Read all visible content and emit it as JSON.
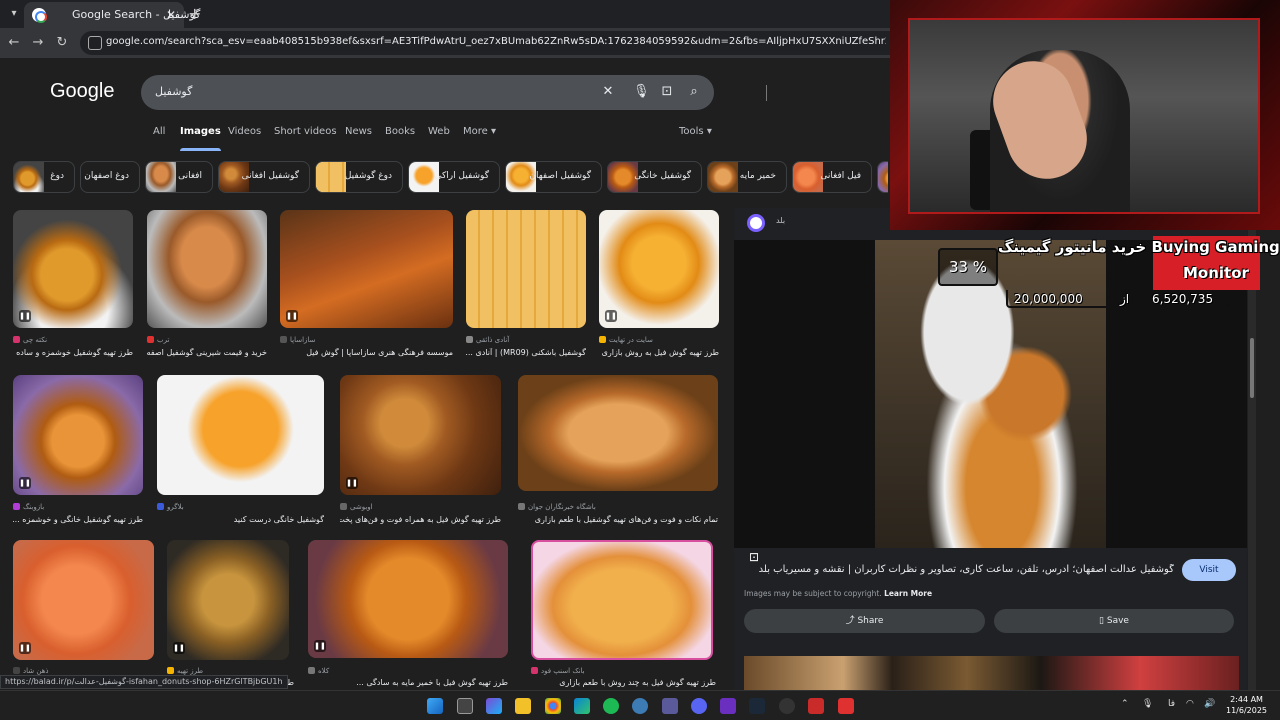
{
  "browser": {
    "tab_title": "Google Search - گوشفیل",
    "url": "google.com/search?sca_esv=eaab408515b938ef&sxsrf=AE3TifPdwAtrU_oez7xBUmab62ZnRw5sDA:1762384059592&udm=2&fbs=AIljpHxU7SXXniUZfeShr2fp4giZ1Y6MJ25_tmWITc7uy4KleoJT"
  },
  "google": {
    "logo": "Google",
    "query": "گوشفیل",
    "filters": [
      "All",
      "Images",
      "Videos",
      "Short videos",
      "News",
      "Books",
      "Web",
      "More ▾"
    ],
    "tools": "Tools ▾",
    "chips": [
      "دوغ",
      "دوغ اصفهان",
      "افغانی",
      "گوشفیل افغانی",
      "دوغ گوشفیل",
      "گوشفیل اراکی",
      "گوشفیل اصفهان",
      "گوشفیل خانگی",
      "خمیر مایه",
      "فیل افغانی"
    ]
  },
  "results": [
    {
      "source": "نکته چی",
      "caption": "طرز تهیه گوشفیل خوشمزه و ساده ..."
    },
    {
      "source": "ترب",
      "caption": "خرید و قیمت شیرینی گوشفیل اصفه..."
    },
    {
      "source": "سازاساپا",
      "caption": "موسسه فرهنگی هنری سازاساپا | گوش فیل"
    },
    {
      "source": "آنادی ذائقی",
      "caption": "گوشفیل باشکنی (MR09) | آنادی ..."
    },
    {
      "source": "سایت در تهایت",
      "caption": "طرز تهیه گوش فیل به روش بازاری ..."
    },
    {
      "source": "بازوبنگ",
      "caption": "طرز تهیه گوشفیل خانگی و خوشمزه ..."
    },
    {
      "source": "بلاگرو",
      "caption": "گوشفیل خانگی درست کنید"
    },
    {
      "source": "اوبوشی",
      "caption": "طرز تهیه گوش فیل به همراه فوت و فن‌های پخت"
    },
    {
      "source": "باشگاه خبرنگاران جوان",
      "caption": "تمام نکات و فوت و فن‌های تهیه گوشفیل با طعم بازاری"
    },
    {
      "source": "ذهن شاد",
      "caption": "طرز تهیه"
    },
    {
      "source": "طرز تهیه",
      "caption": "طرز تهیه"
    },
    {
      "source": "کلاه",
      "caption": "طرز تهیه گوش فیل با خمیر مایه به سادگی ..."
    },
    {
      "source": "بانک اسنپ فود",
      "caption": "طرز تهیه گوش فیل به چند روش با طعم بازاری"
    }
  ],
  "panel": {
    "site": "بلد",
    "title": "گوشفیل عدالت اصفهان؛ آدرس، تلفن، ساعت کاری، تصاویر و نظرات کاربران | نقشه و مسیریاب بلد",
    "visit": "Visit",
    "copyright": "Images may be subject to copyright.",
    "learn_more": "Learn More",
    "share": "Share",
    "save": "Save"
  },
  "status_link": "https://balad.ir/p/گوشفیل-عدالت-isfahan_donuts-shop-6HZrGlTBjbGU1h",
  "promo": {
    "title": "خرید مانیتور گیمینگ Buying Gaming",
    "title2": "Monitor",
    "percent": "33 %",
    "current": "6,520,735",
    "of": "از",
    "target": "20,000,000"
  },
  "taskbar": {
    "lang": "فا",
    "time": "2:44 AM",
    "date": "11/6/2025"
  },
  "colors": {
    "accent": "#8ab4f8",
    "visit_bg": "#a8c7fa",
    "promo_red": "#d61f26"
  }
}
